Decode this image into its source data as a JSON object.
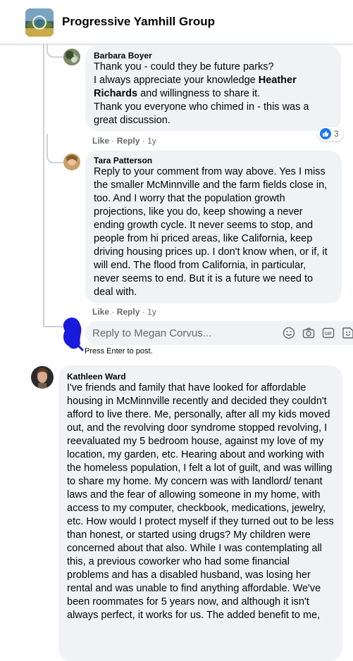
{
  "header": {
    "group_name": "Progressive Yamhill Group"
  },
  "comments": [
    {
      "author": "Barbara Boyer",
      "text_parts": [
        "Thank you - could they be future parks?",
        "I always appreciate your knowledge ",
        "Heather Richards",
        " and willingness to share it.",
        "Thank you everyone who chimed in - this was a great discussion."
      ],
      "like_label": "Like",
      "reply_label": "Reply",
      "separator": "·",
      "time": "1y",
      "reaction_count": "3"
    },
    {
      "author": "Tara Patterson",
      "text": "Reply to your comment from way above. Yes I miss the smaller McMinnville and the farm fields close in, too. And I worry that the population growth projections, like you do, keep showing a never ending growth cycle. It never seems to stop, and people from hi priced areas, like California, keep driving housing prices up. I don't know when, or if, it will end. The flood from California, in particular, never seems to end. But it is a future we need to deal with.",
      "like_label": "Like",
      "reply_label": "Reply",
      "separator": "·",
      "time": "1y"
    },
    {
      "author": "Kathleen Ward",
      "text": "I've friends and family that have looked for affordable housing in McMinnville recently and decided they couldn't afford to live there. Me, personally, after all my kids moved out, and the revolving door syndrome stopped revolving, I reevaluated my 5 bedroom house, against my love of my location, my garden, etc. Hearing about and working with the homeless population, I felt a lot of guilt, and was willing to share my home. My concern was with landlord/ tenant laws and the fear of allowing someone in my home, with access to my computer, checkbook, medications, jewelry, etc. How would I protect myself if they turned out to be less than honest, or started using drugs? My children were concerned about that also. While I was contemplating all this, a previous coworker who had some financial problems and has a disabled husband, was losing her rental and was unable to find anything affordable. We've been roommates for 5 years now, and although it isn't always perfect, it works for us. The added benefit to me,"
    }
  ],
  "reply_box": {
    "placeholder": "Reply to Megan Corvus...",
    "hint": "Press Enter to post."
  },
  "icons": [
    "emoji-icon",
    "camera-icon",
    "gif-icon",
    "sticker-icon",
    "like-reaction-icon"
  ],
  "colors": {
    "bubble": "#f0f2f5",
    "meta_text": "#65676b",
    "like_blue": "#1877f2",
    "redaction": "#1a1adc"
  }
}
